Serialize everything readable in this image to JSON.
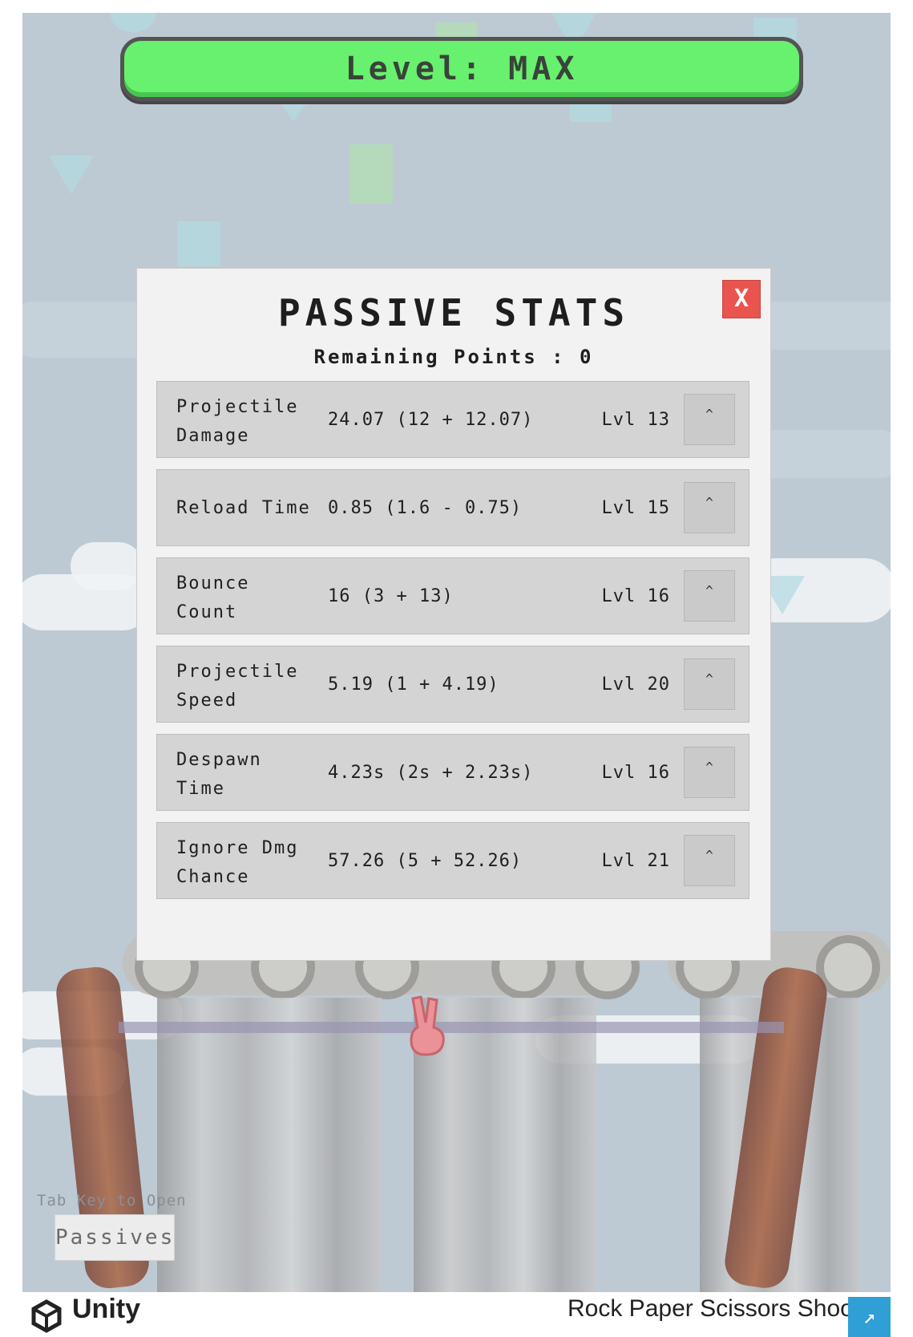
{
  "level_bar": {
    "text": "Level: MAX"
  },
  "panel": {
    "title": "PASSIVE STATS",
    "remaining_points": "Remaining Points :  0",
    "close_label": "X",
    "stats": [
      {
        "name": "Projectile Damage",
        "value": "24.07 (12 + 12.07)",
        "level": "Lvl 13",
        "button": "^"
      },
      {
        "name": "Reload Time",
        "value": "0.85 (1.6 - 0.75)",
        "level": "Lvl 15",
        "button": "^"
      },
      {
        "name": "Bounce Count",
        "value": "16 (3 + 13)",
        "level": "Lvl 16",
        "button": "^"
      },
      {
        "name": "Projectile Speed",
        "value": "5.19 (1 + 4.19)",
        "level": "Lvl 20",
        "button": "^"
      },
      {
        "name": "Despawn Time",
        "value": "4.23s (2s + 2.23s)",
        "level": "Lvl 16",
        "button": "^"
      },
      {
        "name": "Ignore Dmg Chance",
        "value": "57.26 (5 + 52.26)",
        "level": "Lvl 21",
        "button": "^"
      }
    ]
  },
  "hud": {
    "tab_hint": "Tab Key to Open",
    "passives_button": "Passives"
  },
  "footer": {
    "brand": "Unity",
    "game_title": "Rock Paper Scissors Shoot",
    "fullscreen_icon": "fullscreen-icon"
  },
  "colors": {
    "level_bar": "#54f05a",
    "close_button": "#e9544f",
    "background": "#b4c3cd",
    "footer_button": "#2f9fd6"
  }
}
